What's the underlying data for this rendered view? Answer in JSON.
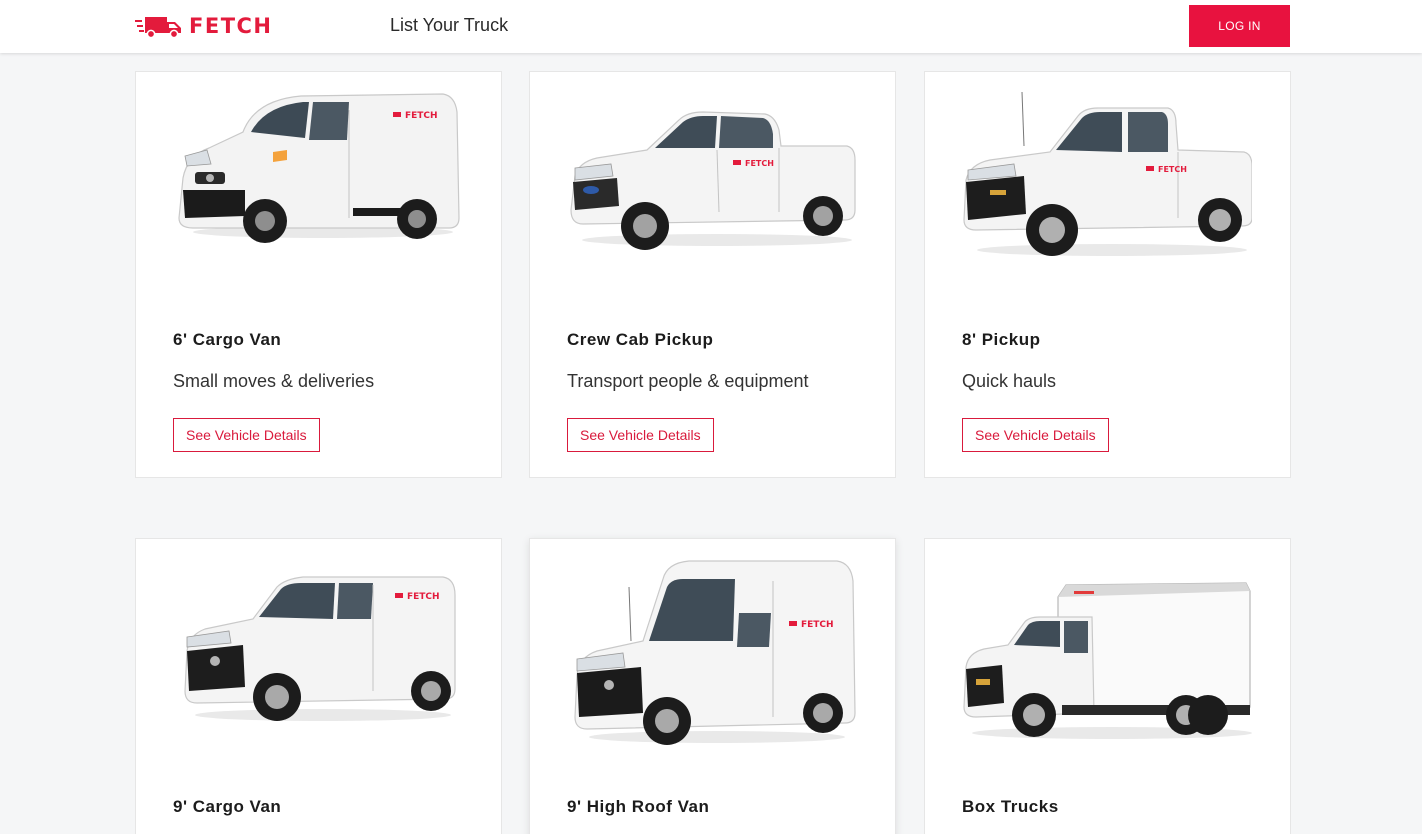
{
  "header": {
    "brand": "FETCH",
    "nav_link": "List Your Truck",
    "login_label": "LOG IN"
  },
  "colors": {
    "brand_red": "#e31b3c",
    "button_red": "#e8123f",
    "background": "#f5f6f7"
  },
  "vehicles": [
    {
      "name": "6' Cargo Van",
      "description": "Small moves & deliveries",
      "button": "See Vehicle Details",
      "icon": "cargo-van-image"
    },
    {
      "name": "Crew Cab Pickup",
      "description": "Transport people & equipment",
      "button": "See Vehicle Details",
      "icon": "crew-cab-pickup-image"
    },
    {
      "name": "8' Pickup",
      "description": "Quick hauls",
      "button": "See Vehicle Details",
      "icon": "pickup-image"
    },
    {
      "name": "9' Cargo Van",
      "icon": "cargo-van-image"
    },
    {
      "name": "9' High Roof Van",
      "icon": "high-roof-van-image"
    },
    {
      "name": "Box Trucks",
      "icon": "box-truck-image"
    }
  ]
}
